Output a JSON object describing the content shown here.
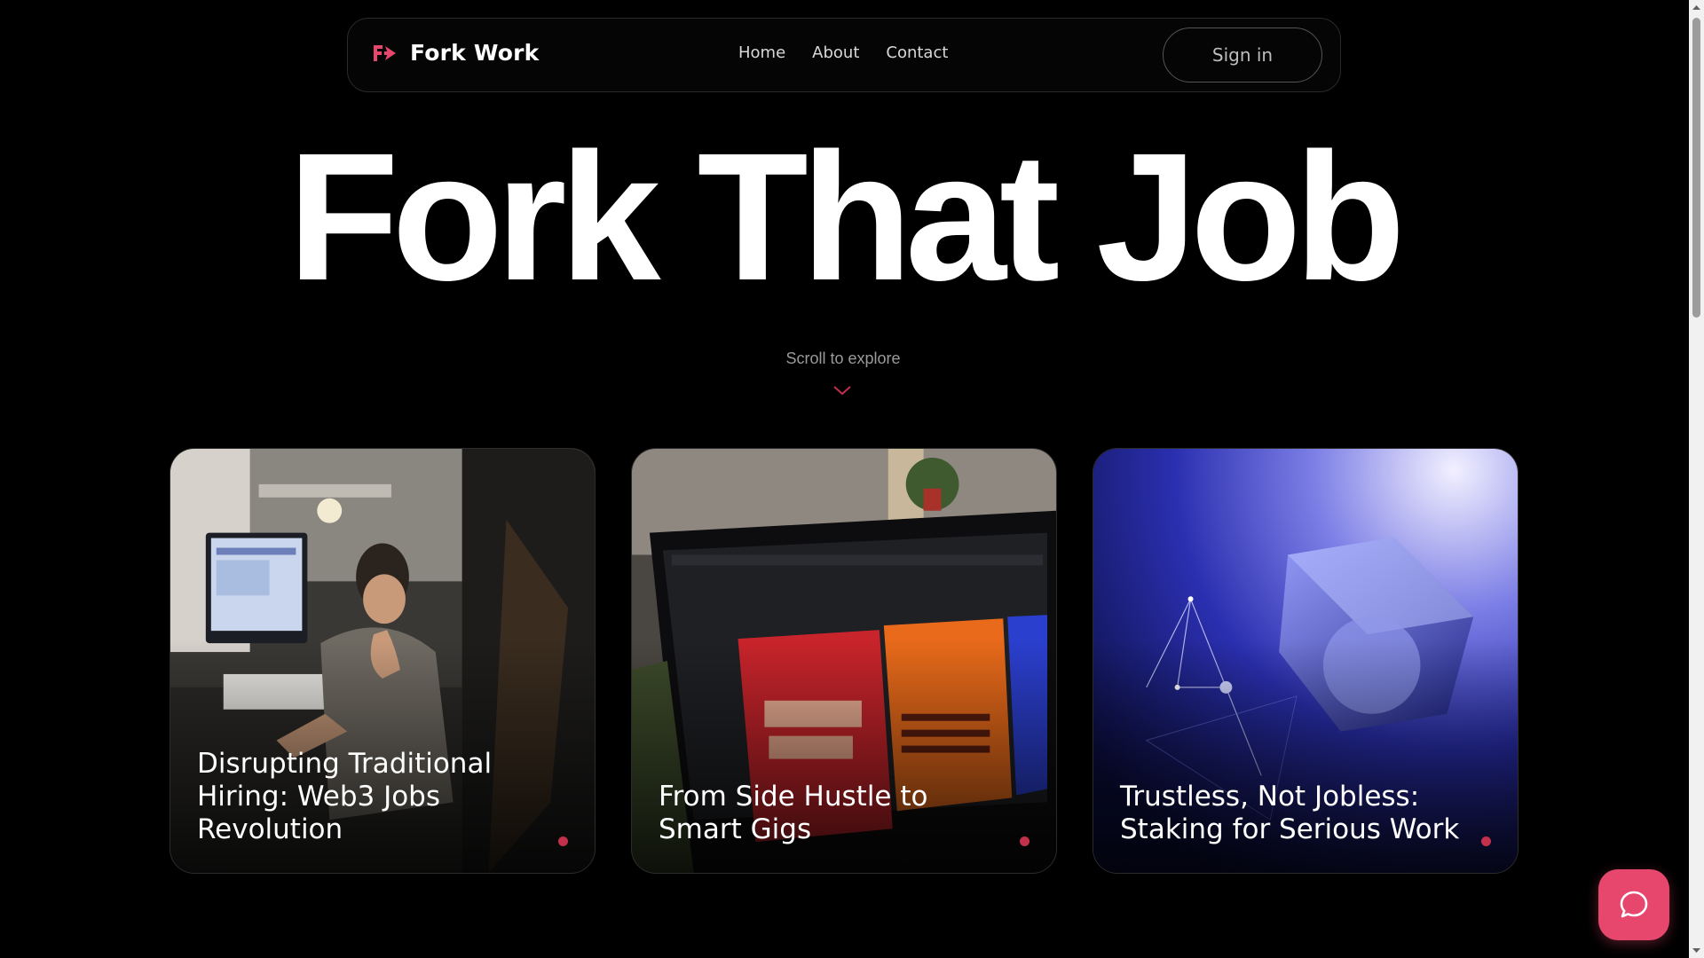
{
  "brand": {
    "name": "Fork Work",
    "logo_icon": "fork-logo-icon",
    "accent": "#e8476d"
  },
  "nav": {
    "items": [
      {
        "label": "Home"
      },
      {
        "label": "About"
      },
      {
        "label": "Contact"
      }
    ]
  },
  "auth": {
    "signin_label": "Sign in"
  },
  "hero": {
    "title": "Fork That Job",
    "scroll_hint": "Scroll to explore"
  },
  "cards": [
    {
      "title": "Disrupting Traditional Hiring: Web3 Jobs Revolution",
      "image_icon": "developer-at-desk-photo"
    },
    {
      "title": "From Side Hustle to Smart Gigs",
      "image_icon": "laptop-photoshop-photo"
    },
    {
      "title": "Trustless, Not Jobless: Staking for Serious Work",
      "image_icon": "glass-cube-render"
    }
  ],
  "chat": {
    "icon": "chat-bubble-icon"
  },
  "colors": {
    "background": "#000000",
    "accent": "#e8476d",
    "card_dot": "#c2304b"
  }
}
